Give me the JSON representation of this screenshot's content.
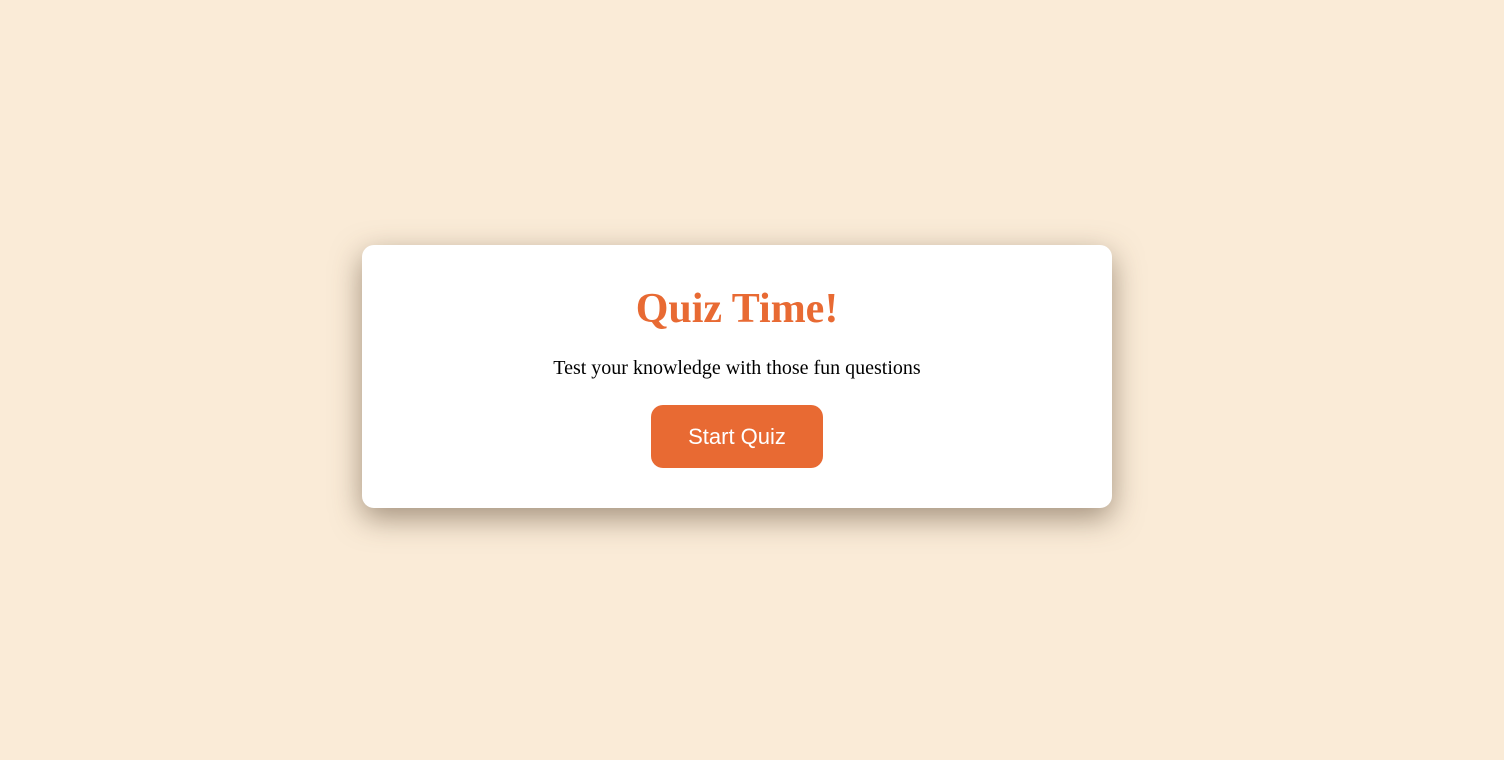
{
  "colors": {
    "background": "#faebd7",
    "card": "#ffffff",
    "accent": "#e86a33",
    "text": "#000000",
    "button_text": "#ffffff"
  },
  "card": {
    "title": "Quiz Time!",
    "subtitle": "Test your knowledge with those fun questions",
    "start_button_label": "Start Quiz"
  }
}
